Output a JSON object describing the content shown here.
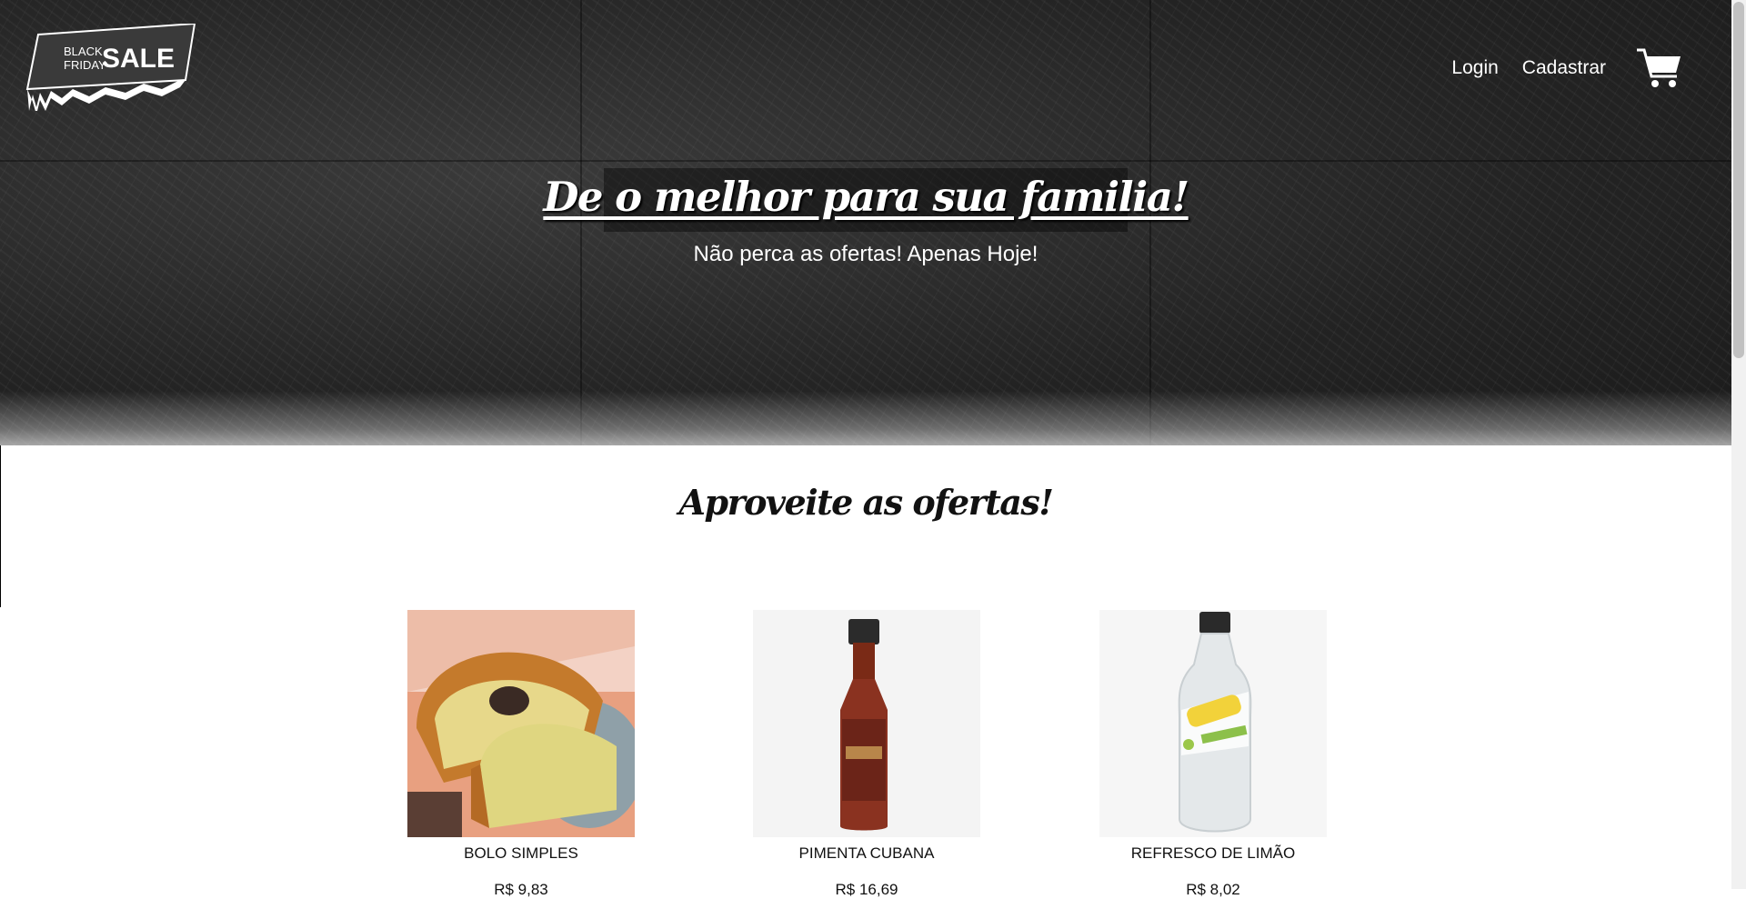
{
  "logo": {
    "line1": "BLACK",
    "line2": "FRIDAY",
    "word": "SALE"
  },
  "nav": {
    "login": "Login",
    "register": "Cadastrar",
    "cart_icon": "shopping-cart-icon"
  },
  "hero": {
    "headline": "De o melhor para sua familia!",
    "subheadline": "Não perca as ofertas! Apenas Hoje!"
  },
  "offers": {
    "title": "Aproveite as ofertas!",
    "products": [
      {
        "name": "BOLO SIMPLES",
        "price": "R$ 9,83",
        "image": "cake-image"
      },
      {
        "name": "PIMENTA CUBANA",
        "price": "R$ 16,69",
        "image": "pepper-sauce-bottle-image"
      },
      {
        "name": "REFRESCO DE LIMÃO",
        "price": "R$ 8,02",
        "image": "soda-bottle-image"
      }
    ]
  },
  "colors": {
    "hero_bg": "#232323",
    "text_light": "#ffffff",
    "text_dark": "#111111"
  }
}
